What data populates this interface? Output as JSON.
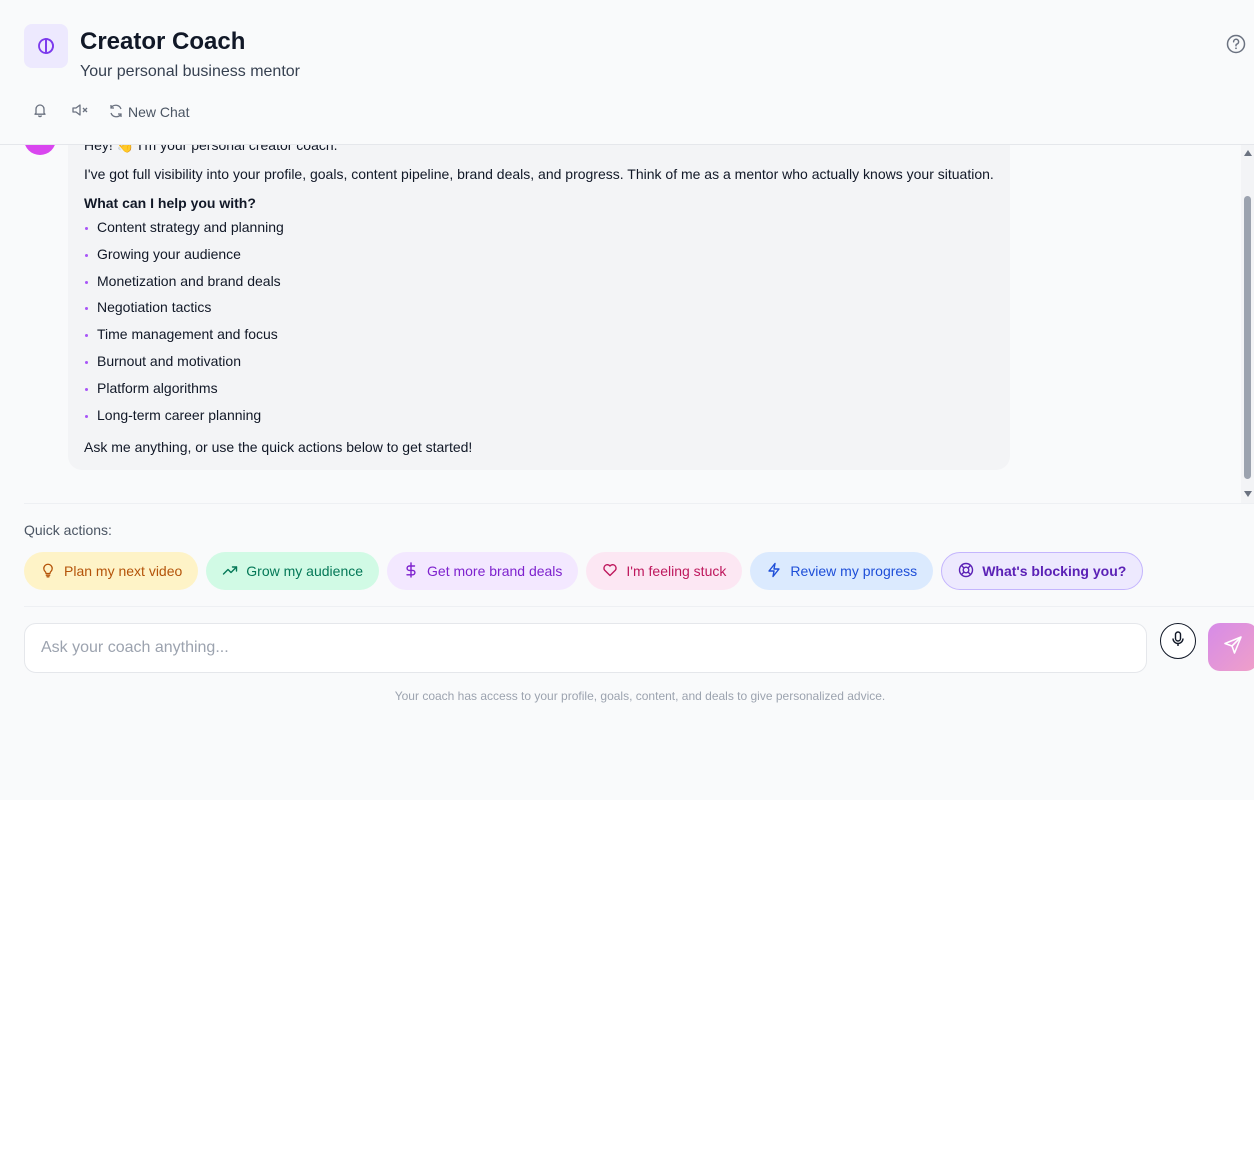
{
  "header": {
    "title": "Creator Coach",
    "subtitle": "Your personal business mentor",
    "new_chat_label": "New Chat"
  },
  "icons": {
    "logo": "logo-icon",
    "help": "help-circle-icon",
    "bell": "bell-icon",
    "mute": "volume-mute-icon",
    "refresh": "refresh-icon",
    "mic": "mic-icon",
    "send": "send-icon"
  },
  "colors": {
    "accent": "#7c3aed",
    "avatar": "#d946ef",
    "bullet": "#a855f7"
  },
  "message": {
    "greeting": "Hey! 👋 I'm your personal creator coach.",
    "intro": "I've got full visibility into your profile, goals, content pipeline, brand deals, and progress. Think of me as a mentor who actually knows your situation.",
    "help_heading": "What can I help you with?",
    "topics": [
      "Content strategy and planning",
      "Growing your audience",
      "Monetization and brand deals",
      "Negotiation tactics",
      "Time management and focus",
      "Burnout and motivation",
      "Platform algorithms",
      "Long-term career planning"
    ],
    "outro": "Ask me anything, or use the quick actions below to get started!"
  },
  "quick_actions": {
    "label": "Quick actions:",
    "items": [
      {
        "label": "Plan my next video",
        "icon": "lightbulb-icon"
      },
      {
        "label": "Grow my audience",
        "icon": "trending-up-icon"
      },
      {
        "label": "Get more brand deals",
        "icon": "dollar-icon"
      },
      {
        "label": "I'm feeling stuck",
        "icon": "heart-icon"
      },
      {
        "label": "Review my progress",
        "icon": "lightning-icon"
      },
      {
        "label": "What's blocking you?",
        "icon": "lifebuoy-icon"
      }
    ]
  },
  "composer": {
    "placeholder": "Ask your coach anything...",
    "value": "",
    "footnote": "Your coach has access to your profile, goals, content, and deals to give personalized advice."
  }
}
